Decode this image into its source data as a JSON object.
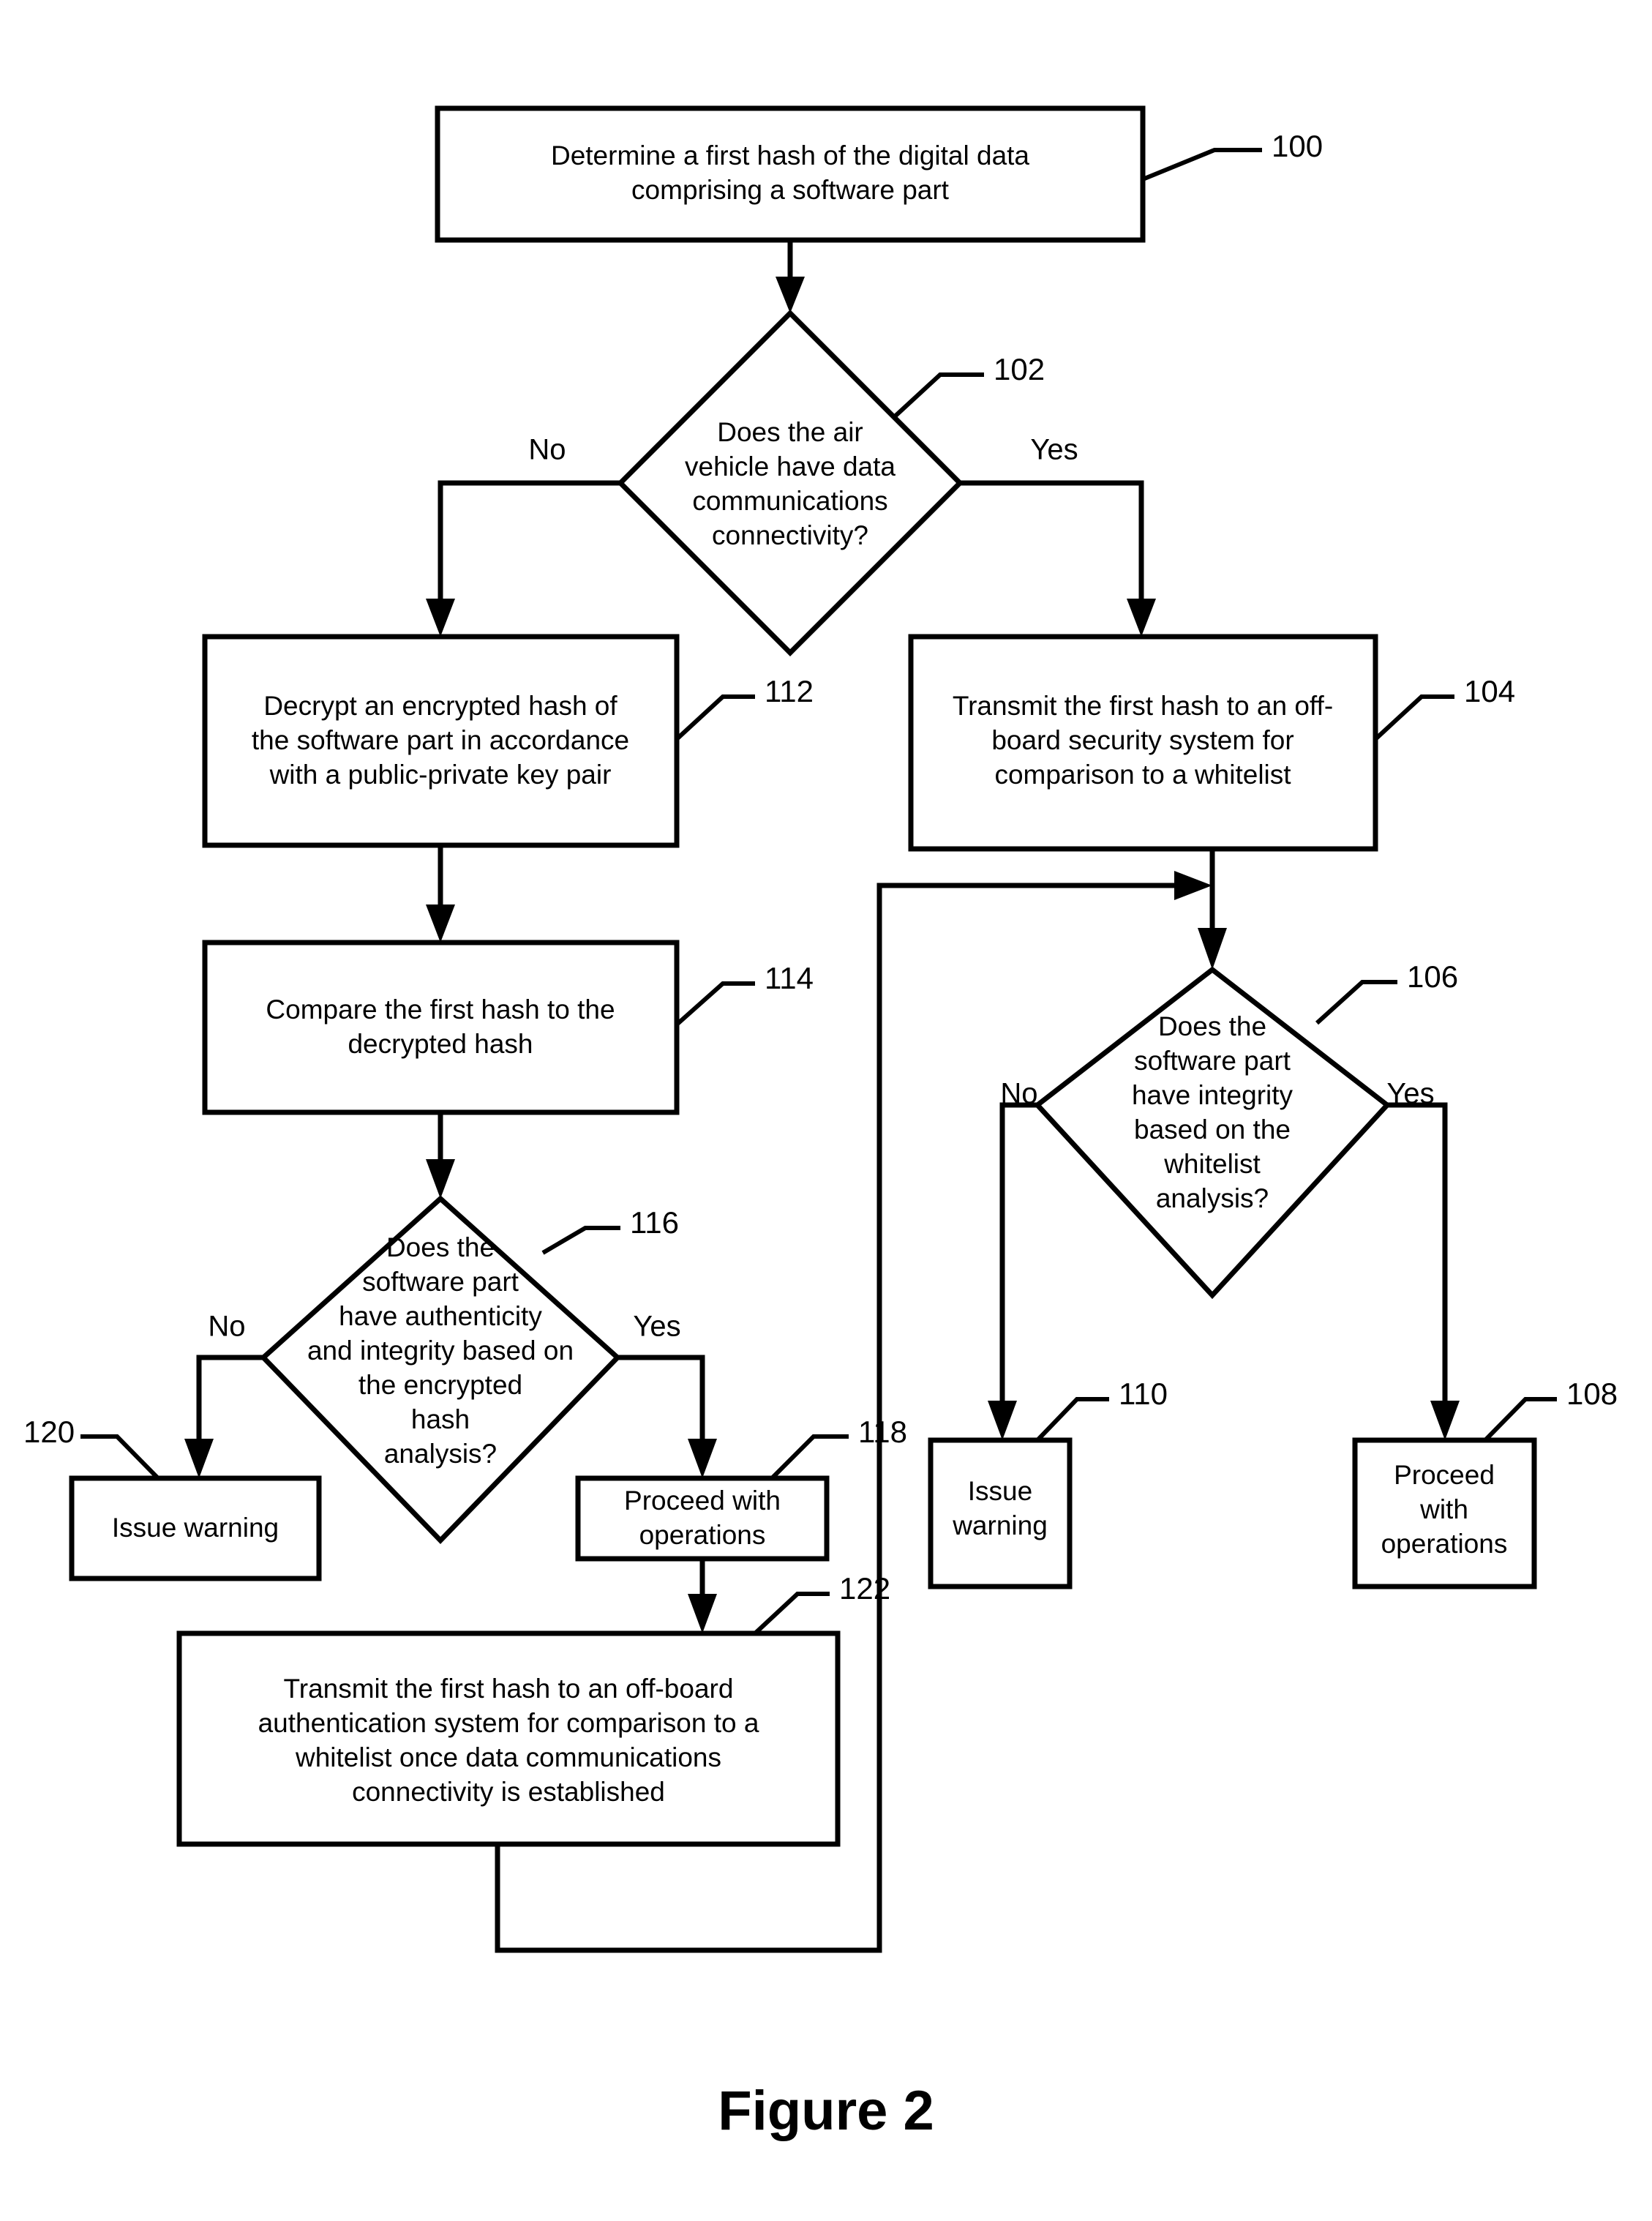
{
  "figure": {
    "caption": "Figure 2",
    "title": "Software part authenticity and integrity verification flowchart"
  },
  "nodes": [
    {
      "id": "n100",
      "ref": "100",
      "type": "process",
      "lines": [
        "Determine a first hash of the digital data",
        "comprising a software part"
      ]
    },
    {
      "id": "n102",
      "ref": "102",
      "type": "decision",
      "lines": [
        "Does the air",
        "vehicle have data",
        "communications",
        "connectivity?"
      ],
      "branch_left": "No",
      "branch_right": "Yes"
    },
    {
      "id": "n112",
      "ref": "112",
      "type": "process",
      "lines": [
        "Decrypt an encrypted hash of",
        "the software part in accordance",
        "with a public-private key pair"
      ]
    },
    {
      "id": "n104",
      "ref": "104",
      "type": "process",
      "lines": [
        "Transmit the first hash to an off-",
        "board security system for",
        "comparison to a whitelist"
      ]
    },
    {
      "id": "n114",
      "ref": "114",
      "type": "process",
      "lines": [
        "Compare the first hash to the",
        "decrypted hash"
      ]
    },
    {
      "id": "n106",
      "ref": "106",
      "type": "decision",
      "lines": [
        "Does the",
        "software part",
        "have integrity",
        "based on the",
        "whitelist",
        "analysis?"
      ],
      "branch_left": "No",
      "branch_right": "Yes"
    },
    {
      "id": "n116",
      "ref": "116",
      "type": "decision",
      "lines": [
        "Does the",
        "software part",
        "have authenticity",
        "and integrity based on",
        "the encrypted",
        "hash",
        "analysis?"
      ],
      "branch_left": "No",
      "branch_right": "Yes"
    },
    {
      "id": "n120",
      "ref": "120",
      "type": "process",
      "lines": [
        "Issue warning"
      ]
    },
    {
      "id": "n118",
      "ref": "118",
      "type": "process",
      "lines": [
        "Proceed with",
        "operations"
      ]
    },
    {
      "id": "n110",
      "ref": "110",
      "type": "process",
      "lines": [
        "Issue",
        "warning"
      ]
    },
    {
      "id": "n108",
      "ref": "108",
      "type": "process",
      "lines": [
        "Proceed",
        "with",
        "operations"
      ]
    },
    {
      "id": "n122",
      "ref": "122",
      "type": "process",
      "lines": [
        "Transmit the first hash to an off-board",
        "authentication system for comparison to a",
        "whitelist once data communications",
        "connectivity is established"
      ]
    }
  ],
  "colors": {
    "ink": "#000000",
    "paper": "#ffffff"
  }
}
